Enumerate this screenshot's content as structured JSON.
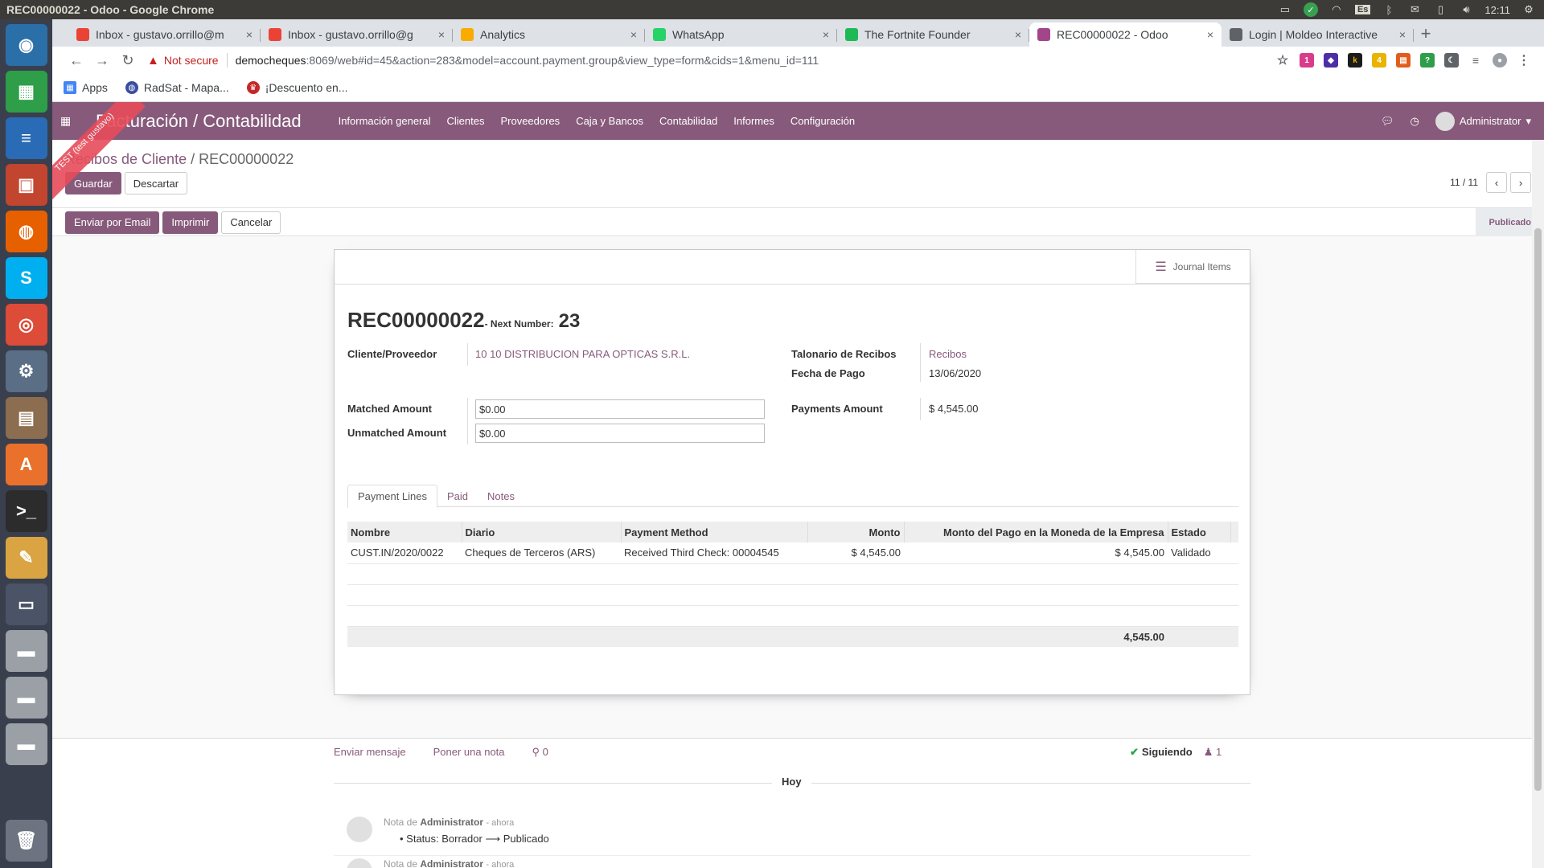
{
  "os": {
    "window_title": "REC00000022 - Odoo - Google Chrome",
    "keyboard_layout": "Es",
    "clock": "12:11"
  },
  "browser": {
    "tabs": [
      {
        "title": "Inbox - gustavo.orrillo@m",
        "icon": "gmail-icon",
        "color": "#ea4335"
      },
      {
        "title": "Inbox - gustavo.orrillo@g",
        "icon": "gmail-icon",
        "color": "#ea4335"
      },
      {
        "title": "Analytics",
        "icon": "analytics-icon",
        "color": "#f9ab00"
      },
      {
        "title": "WhatsApp",
        "icon": "whatsapp-icon",
        "color": "#25d366"
      },
      {
        "title": "The Fortnite Founder",
        "icon": "spotify-icon",
        "color": "#1db954"
      },
      {
        "title": "REC00000022 - Odoo",
        "icon": "odoo-icon",
        "color": "#a24689"
      },
      {
        "title": "Login | Moldeo Interactive",
        "icon": "moldeo-icon",
        "color": "#5f6368"
      }
    ],
    "active_tab": 5,
    "not_secure_label": "Not secure",
    "url_host": "democheques",
    "url_rest": ":8069/web#id=45&action=283&model=account.payment.group&view_type=form&cids=1&menu_id=111",
    "bookmarks": [
      {
        "label": "Apps",
        "icon": "apps-grid-icon"
      },
      {
        "label": "RadSat - Mapa...",
        "icon": "radsat-icon"
      },
      {
        "label": "¡Descuento en...",
        "icon": "discount-icon"
      }
    ]
  },
  "odoo": {
    "brand": "Facturación / Contabilidad",
    "menu": [
      "Información general",
      "Clientes",
      "Proveedores",
      "Caja y Bancos",
      "Contabilidad",
      "Informes",
      "Configuración"
    ],
    "user": "Administrator",
    "ribbon": "TEST (test gustavo)",
    "breadcrumb_parent": "Recibos de Cliente",
    "breadcrumb_current": "REC00000022",
    "save_label": "Guardar",
    "discard_label": "Descartar",
    "pager": "11 / 11",
    "email_label": "Enviar por Email",
    "print_label": "Imprimir",
    "cancel_label": "Cancelar",
    "state": "Publicado",
    "journal_items_label": "Journal Items",
    "record_name": "REC00000022",
    "next_number_label": "- Next Number:",
    "next_number": "23",
    "fields": {
      "partner_label": "Cliente/Proveedor",
      "partner_value": "10 10 DISTRIBUCION PARA OPTICAS S.R.L.",
      "receiptbook_label": "Talonario de Recibos",
      "receiptbook_value": "Recibos",
      "payment_date_label": "Fecha de Pago",
      "payment_date_value": "13/06/2020",
      "matched_label": "Matched Amount",
      "matched_value": "$0.00",
      "unmatched_label": "Unmatched Amount",
      "unmatched_value": "$0.00",
      "payments_amount_label": "Payments Amount",
      "payments_amount_value": "$ 4,545.00"
    },
    "notebook_tabs": [
      "Payment Lines",
      "Paid",
      "Notes"
    ],
    "lines": {
      "headers": [
        "Nombre",
        "Diario",
        "Payment Method",
        "Monto",
        "Monto del Pago en la Moneda de la Empresa",
        "Estado"
      ],
      "rows": [
        [
          "CUST.IN/2020/0022",
          "Cheques de Terceros (ARS)",
          "Received Third Check: 00004545",
          "$ 4,545.00",
          "$ 4,545.00",
          "Validado"
        ]
      ],
      "total": "4,545.00"
    },
    "chatter": {
      "send_message": "Enviar mensaje",
      "log_note": "Poner una nota",
      "attachments": "0",
      "following": "Siguiendo",
      "followers": "1",
      "date_separator": "Hoy",
      "messages": [
        {
          "prefix": "Nota de",
          "author": "Administrator",
          "when": "- ahora",
          "body": "Status: Borrador ⟶ Publicado"
        },
        {
          "prefix": "Nota de",
          "author": "Administrator",
          "when": "- ahora",
          "body": ""
        }
      ]
    }
  }
}
